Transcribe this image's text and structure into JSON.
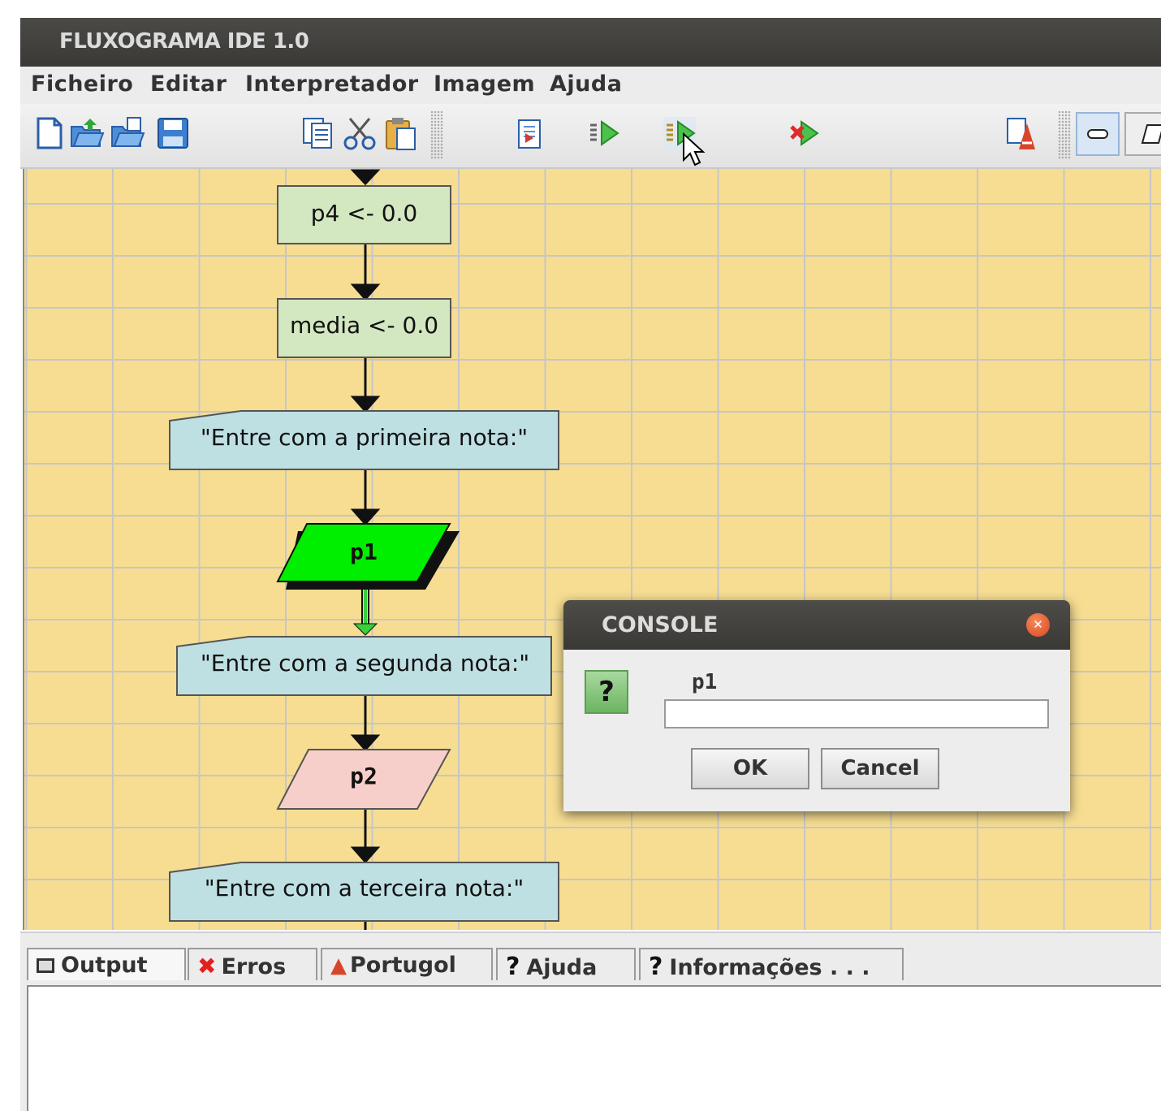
{
  "window": {
    "title": "FLUXOGRAMA IDE 1.0"
  },
  "menu": [
    "Ficheiro",
    "Editar",
    "Interpretador",
    "Imagem",
    "Ajuda"
  ],
  "toolbar": {
    "icons": [
      "new-file-icon",
      "open-folder-icon",
      "open-recent-icon",
      "save-icon",
      "copy-icon",
      "cut-icon",
      "paste-icon",
      "export-icon",
      "run-icon",
      "step-run-icon",
      "stop-icon",
      "portugol-icon",
      "terminator-shape-tool",
      "parallelogram-shape-tool"
    ]
  },
  "flowchart": {
    "nodes": [
      {
        "type": "process",
        "text": "p4 <- 0.0"
      },
      {
        "type": "process",
        "text": "media <- 0.0"
      },
      {
        "type": "output",
        "text": "\"Entre com a primeira nota:\""
      },
      {
        "type": "input",
        "text": "p1",
        "state": "active"
      },
      {
        "type": "output",
        "text": "\"Entre com a segunda nota:\""
      },
      {
        "type": "input",
        "text": "p2",
        "state": "pending"
      },
      {
        "type": "output",
        "text": "\"Entre com a terceira nota:\""
      }
    ]
  },
  "dialog": {
    "title": "CONSOLE",
    "label": "p1",
    "input_value": "",
    "ok_label": "OK",
    "cancel_label": "Cancel"
  },
  "bottom_tabs": [
    {
      "label": "Output",
      "icon": "console-icon"
    },
    {
      "label": "Erros",
      "icon": "error-x-icon"
    },
    {
      "label": "Portugol",
      "icon": "portugol-icon"
    },
    {
      "label": "Ajuda",
      "icon": "question-icon"
    },
    {
      "label": "Informações . . .",
      "icon": "question-icon"
    }
  ],
  "colors": {
    "canvas": "#f6dd92",
    "process": "#d3e7c0",
    "output": "#bfe0e3",
    "input_active": "#00ee00",
    "input_pending": "#f7cfca"
  }
}
